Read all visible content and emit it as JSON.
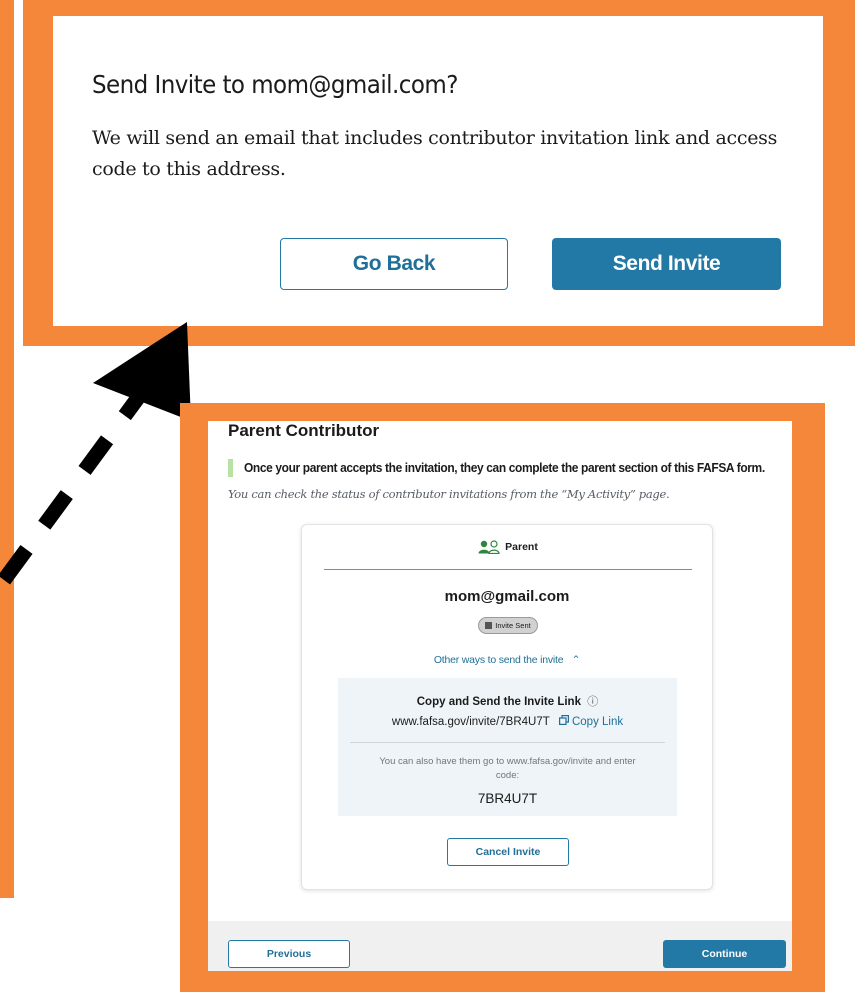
{
  "dialog": {
    "title": "Send Invite to mom@gmail.com?",
    "body": "We will send an email that includes contributor invitation link and access code to this address.",
    "go_back_label": "Go Back",
    "send_invite_label": "Send Invite"
  },
  "page": {
    "title": "Parent Contributor",
    "notice": "Once your parent accepts the invitation, they can complete the parent section of this FAFSA form.",
    "helper": "You can check the status of contributor invitations from the “My Activity” page.",
    "card": {
      "role_label": "Parent",
      "role_icon": "people-icon",
      "email": "mom@gmail.com",
      "status_badge": "Invite Sent",
      "other_ways_label": "Other ways to send the invite",
      "other_ways_icon": "chevron-up-icon",
      "link_box": {
        "title": "Copy and Send the Invite Link",
        "info_icon": "info-icon",
        "url": "www.fafsa.gov/invite/7BR4U7T",
        "copy_label": "Copy Link",
        "copy_icon": "copy-icon",
        "also_text": "You can also have them go to www.fafsa.gov/invite and enter code:",
        "code": "7BR4U7T"
      },
      "cancel_label": "Cancel Invite"
    },
    "footer": {
      "previous_label": "Previous",
      "continue_label": "Continue"
    }
  },
  "colors": {
    "highlight_frame": "#f5873a",
    "primary": "#2379a6",
    "link": "#1f6f99",
    "notice_bar": "#b6e3a3",
    "icon_green": "#2e8540"
  }
}
